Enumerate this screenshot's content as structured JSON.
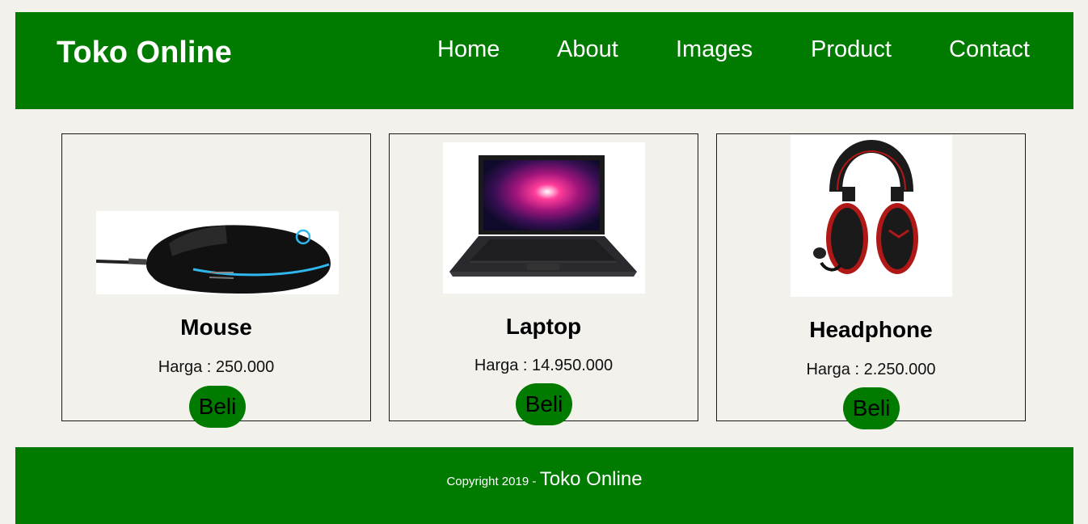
{
  "header": {
    "brand": "Toko Online",
    "nav": [
      "Home",
      "About",
      "Images",
      "Product",
      "Contact"
    ]
  },
  "products": [
    {
      "name": "Mouse",
      "price": "Harga : 250.000",
      "button": "Beli",
      "image": "gaming-mouse-image"
    },
    {
      "name": "Laptop",
      "price": "Harga : 14.950.000",
      "button": "Beli",
      "image": "laptop-image"
    },
    {
      "name": "Headphone",
      "price": "Harga : 2.250.000",
      "button": "Beli",
      "image": "headphone-image"
    }
  ],
  "footer": {
    "prefix": "Copyright 2019 -",
    "brand": "Toko Online"
  },
  "colors": {
    "primary_green": "#007b00",
    "page_background": "#f2f1ec"
  }
}
